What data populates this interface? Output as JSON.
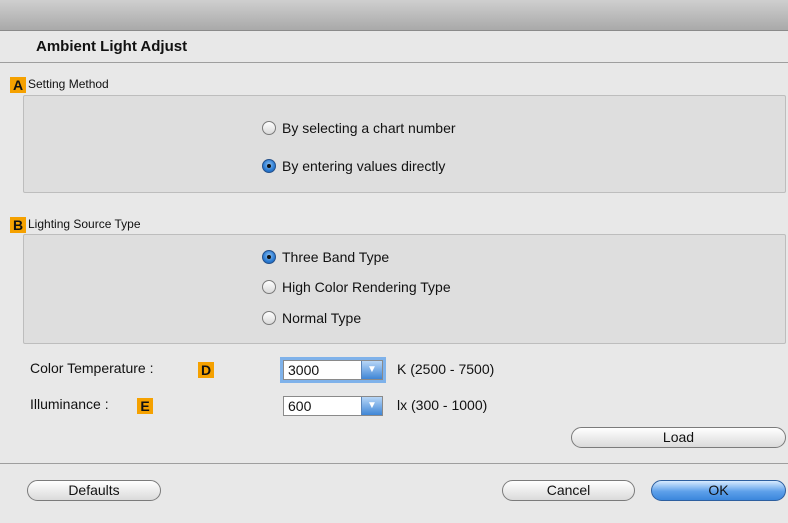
{
  "dialog": {
    "title": "Ambient Light Adjust"
  },
  "setting_method": {
    "badge": "A",
    "label": "Setting Method",
    "options": [
      {
        "label": "By selecting a chart number",
        "selected": false
      },
      {
        "label": "By entering values directly",
        "selected": true
      }
    ]
  },
  "lighting_source": {
    "badge": "B",
    "label": "Lighting Source Type",
    "options": [
      {
        "label": "Three Band Type",
        "selected": true
      },
      {
        "label": "High Color Rendering Type",
        "selected": false
      },
      {
        "label": "Normal Type",
        "selected": false
      }
    ]
  },
  "color_temperature": {
    "label": "Color Temperature :",
    "badge": "D",
    "value": "3000",
    "range": "K (2500 - 7500)"
  },
  "illuminance": {
    "label": "Illuminance :",
    "badge": "E",
    "value": "600",
    "range": "lx (300 - 1000)"
  },
  "buttons": {
    "load": "Load",
    "defaults": "Defaults",
    "cancel": "Cancel",
    "ok": "OK"
  },
  "colors": {
    "badge": "#f5a100",
    "accent": "#3b86dc"
  }
}
